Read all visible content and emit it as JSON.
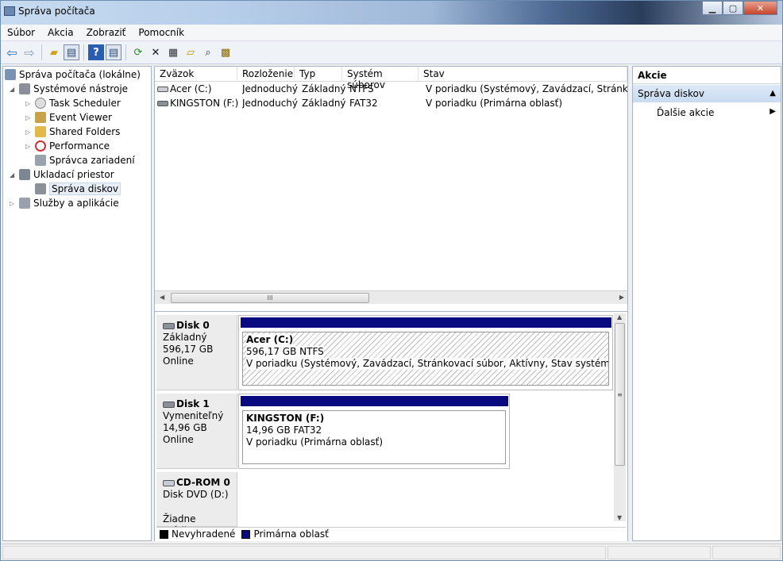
{
  "window": {
    "title": "Správa počítača",
    "min": "▭",
    "max": "▢",
    "close": "✕"
  },
  "menu": [
    "Súbor",
    "Akcia",
    "Zobraziť",
    "Pomocník"
  ],
  "toolbar_icons": [
    "back-icon",
    "forward-icon",
    "up-folder-icon",
    "show-hide-tree-icon",
    "help-icon",
    "show-hide-action-pane-icon",
    "refresh-icon",
    "delete-icon",
    "properties-icon",
    "open-icon",
    "search-icon",
    "settings-icon"
  ],
  "tree": {
    "root": "Správa počítača (lokálne)",
    "system_tools": "Systémové nástroje",
    "task_scheduler": "Task Scheduler",
    "event_viewer": "Event Viewer",
    "shared_folders": "Shared Folders",
    "performance": "Performance",
    "device_manager": "Správca zariadení",
    "storage": "Ukladací priestor",
    "disk_mgmt": "Správa diskov",
    "services": "Služby a aplikácie"
  },
  "volumes": {
    "headers": [
      "Zväzok",
      "Rozloženie",
      "Typ",
      "Systém súborov",
      "Stav"
    ],
    "rows": [
      {
        "name": "Acer (C:)",
        "layout": "Jednoduchý",
        "type": "Základný",
        "fs": "NTFS",
        "status": "V poriadku (Systémový, Zavádzací, Stránkovací s"
      },
      {
        "name": "KINGSTON (F:)",
        "layout": "Jednoduchý",
        "type": "Základný",
        "fs": "FAT32",
        "status": "V poriadku (Primárna oblasť)"
      }
    ],
    "hscroll_grip": "III"
  },
  "disks": [
    {
      "name": "Disk 0",
      "type": "Základný",
      "size": "596,17 GB",
      "state": "Online",
      "part_name": "Acer  (C:)",
      "part_size": "596,17 GB NTFS",
      "part_status": "V poriadku (Systémový, Zavádzací, Stránkovací súbor, Aktívny, Stav systému pri zlyhan"
    },
    {
      "name": "Disk 1",
      "type": "Vymeniteľný",
      "size": "14,96 GB",
      "state": "Online",
      "part_name": "KINGSTON  (F:)",
      "part_size": "14,96 GB FAT32",
      "part_status": "V poriadku (Primárna oblasť)"
    },
    {
      "name": "CD-ROM 0",
      "type": "Disk DVD (D:)",
      "size": "",
      "state": "Žiadne médium"
    }
  ],
  "vscroll_grip": "≡",
  "legend": {
    "unallocated": "Nevyhradené",
    "primary": "Primárna oblasť",
    "unallocated_color": "#000000",
    "primary_color": "#0a0a80"
  },
  "actions": {
    "header": "Akcie",
    "section": "Správa diskov",
    "more": "Ďalšie akcie"
  }
}
